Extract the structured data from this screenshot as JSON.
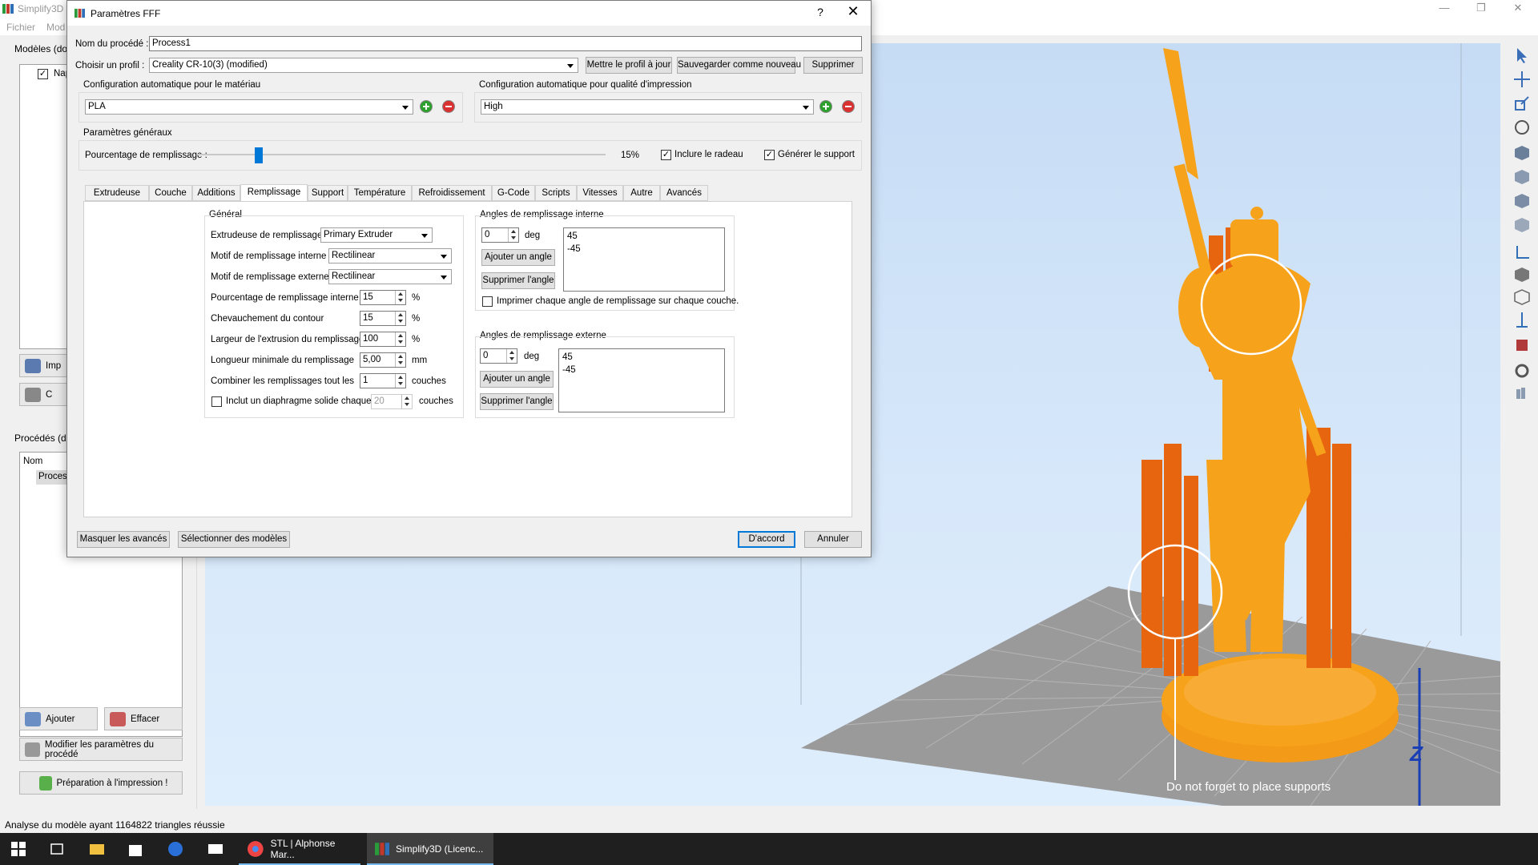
{
  "app": {
    "title": "Simplify3D",
    "menu": [
      "Fichier",
      "Mod"
    ],
    "status": "Analyse du modèle ayant 1164822 triangles réussie"
  },
  "left_panel": {
    "models_label": "Modèles (dou",
    "model_item": "Nap",
    "import_label": "Imp",
    "center_label": "C",
    "processes_label": "Procédés (do",
    "processes_col": "Nom",
    "process_item": "Proces",
    "add_button": "Ajouter",
    "delete_button": "Effacer",
    "edit_process_button": "Modifier les paramètres du procédé",
    "prepare_button": "Préparation à l'impression !"
  },
  "viewport": {
    "annotation": "Do not forget to place supports",
    "axis_label": "Z"
  },
  "taskbar": {
    "tasks": [
      {
        "label": "STL | Alphonse Mar..."
      },
      {
        "label": "Simplify3D (Licenc..."
      }
    ]
  },
  "dialog": {
    "title": "Paramètres FFF",
    "help": "?",
    "close": "✕",
    "process_name_label": "Nom du procédé :",
    "process_name_value": "Process1",
    "profile_label": "Choisir un profil :",
    "profile_value": "Creality CR-10(3) (modified)",
    "update_profile_btn": "Mettre le profil à jour",
    "save_new_btn": "Sauvegarder comme nouveau",
    "delete_btn": "Supprimer",
    "material_group_label": "Configuration automatique pour le matériau",
    "material_value": "PLA",
    "quality_group_label": "Configuration automatique pour qualité d'impression",
    "quality_value": "High",
    "general_group_label": "Paramètres généraux",
    "infill_pct_label": "Pourcentage de remplissage :",
    "infill_pct_value": "15%",
    "infill_pct_fraction": 0.15,
    "include_raft_label": "Inclure le radeau",
    "include_raft_checked": true,
    "generate_support_label": "Générer le support",
    "generate_support_checked": true,
    "tabs": [
      "Extrudeuse",
      "Couche",
      "Additions",
      "Remplissage",
      "Support",
      "Température",
      "Refroidissement",
      "G-Code",
      "Scripts",
      "Vitesses",
      "Autre",
      "Avancés"
    ],
    "active_tab": "Remplissage",
    "infill": {
      "general_label": "Général",
      "extruder_label": "Extrudeuse de remplissage",
      "extruder_value": "Primary Extruder",
      "internal_pattern_label": "Motif de remplissage interne",
      "internal_pattern_value": "Rectilinear",
      "external_pattern_label": "Motif de remplissage externe",
      "external_pattern_value": "Rectilinear",
      "internal_pct_label": "Pourcentage de remplissage interne",
      "internal_pct_value": "15",
      "outline_overlap_label": "Chevauchement du contour",
      "outline_overlap_value": "15",
      "extrusion_width_label": "Largeur de l'extrusion du remplissage",
      "extrusion_width_value": "100",
      "min_length_label": "Longueur minimale du remplissage",
      "min_length_value": "5,00",
      "combine_label": "Combiner les remplissages tout les",
      "combine_value": "1",
      "solid_diaphragm_label": "Inclut un diaphragme solide chaque",
      "solid_diaphragm_value": "20",
      "pct_unit": "%",
      "mm_unit": "mm",
      "layers_unit": "couches",
      "internal_angles_label": "Angles de remplissage interne",
      "internal_angle_input": "0",
      "deg_unit": "deg",
      "internal_angles": [
        "45",
        "-45"
      ],
      "add_angle_btn": "Ajouter un angle",
      "remove_angle_btn": "Supprimer l'angle",
      "print_every_angle_label": "Imprimer chaque angle de remplissage sur chaque couche.",
      "external_angles_label": "Angles de remplissage externe",
      "external_angle_input": "0",
      "external_angles": [
        "45",
        "-45"
      ]
    },
    "hide_advanced_btn": "Masquer les avancés",
    "select_models_btn": "Sélectionner des modèles",
    "ok_btn": "D'accord",
    "cancel_btn": "Annuler"
  },
  "colors": {
    "model_orange": "#f7a21b",
    "support_orange": "#e8650f",
    "accent": "#0078d7",
    "bed_grey": "#9a9a9a"
  }
}
